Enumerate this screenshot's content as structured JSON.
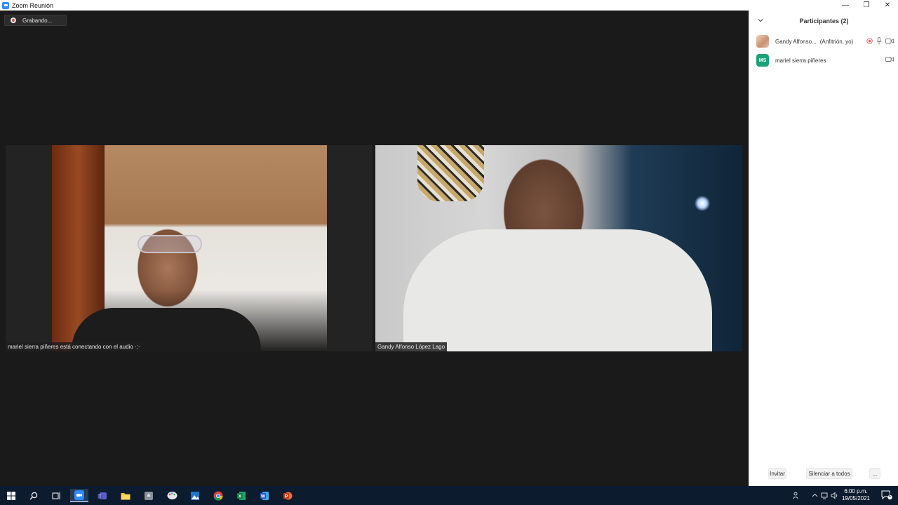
{
  "window": {
    "title": "Zoom Reunión",
    "minimize": "—",
    "restore": "❐",
    "close": "✕"
  },
  "meeting": {
    "recording_label": "Grabando...",
    "tiles": [
      {
        "name_tag": "mariel sierra piñeres está conectando con el audio ·:·"
      },
      {
        "name_tag": "Gandy Alfonso López Lago"
      }
    ]
  },
  "participants_panel": {
    "title": "Participantes (2)",
    "participants": [
      {
        "name": "Gandy Alfonso...",
        "role": "(Anfitrión, yo)",
        "avatar_type": "photo",
        "avatar_initials": "",
        "icons": [
          "recording-icon",
          "microphone-icon",
          "video-camera-icon"
        ]
      },
      {
        "name": "mariel sierra piñeres",
        "role": "",
        "avatar_type": "initials",
        "avatar_initials": "MS",
        "avatar_color": "#1aa37a",
        "icons": [
          "video-camera-icon"
        ]
      }
    ],
    "buttons": {
      "invite": "Invitar",
      "mute_all": "Silenciar a todos",
      "more": "..."
    }
  },
  "taskbar": {
    "apps": [
      "windows-start-icon",
      "search-icon",
      "task-view-icon",
      "zoom-icon",
      "teams-icon",
      "file-explorer-icon",
      "app-icon",
      "paint-icon",
      "photos-icon",
      "chrome-icon",
      "excel-icon",
      "word-icon",
      "powerpoint-icon"
    ],
    "active_app": "zoom-icon",
    "clock_time": "6:00 p.m.",
    "clock_date": "19/05/2021",
    "notification_count": "2"
  }
}
